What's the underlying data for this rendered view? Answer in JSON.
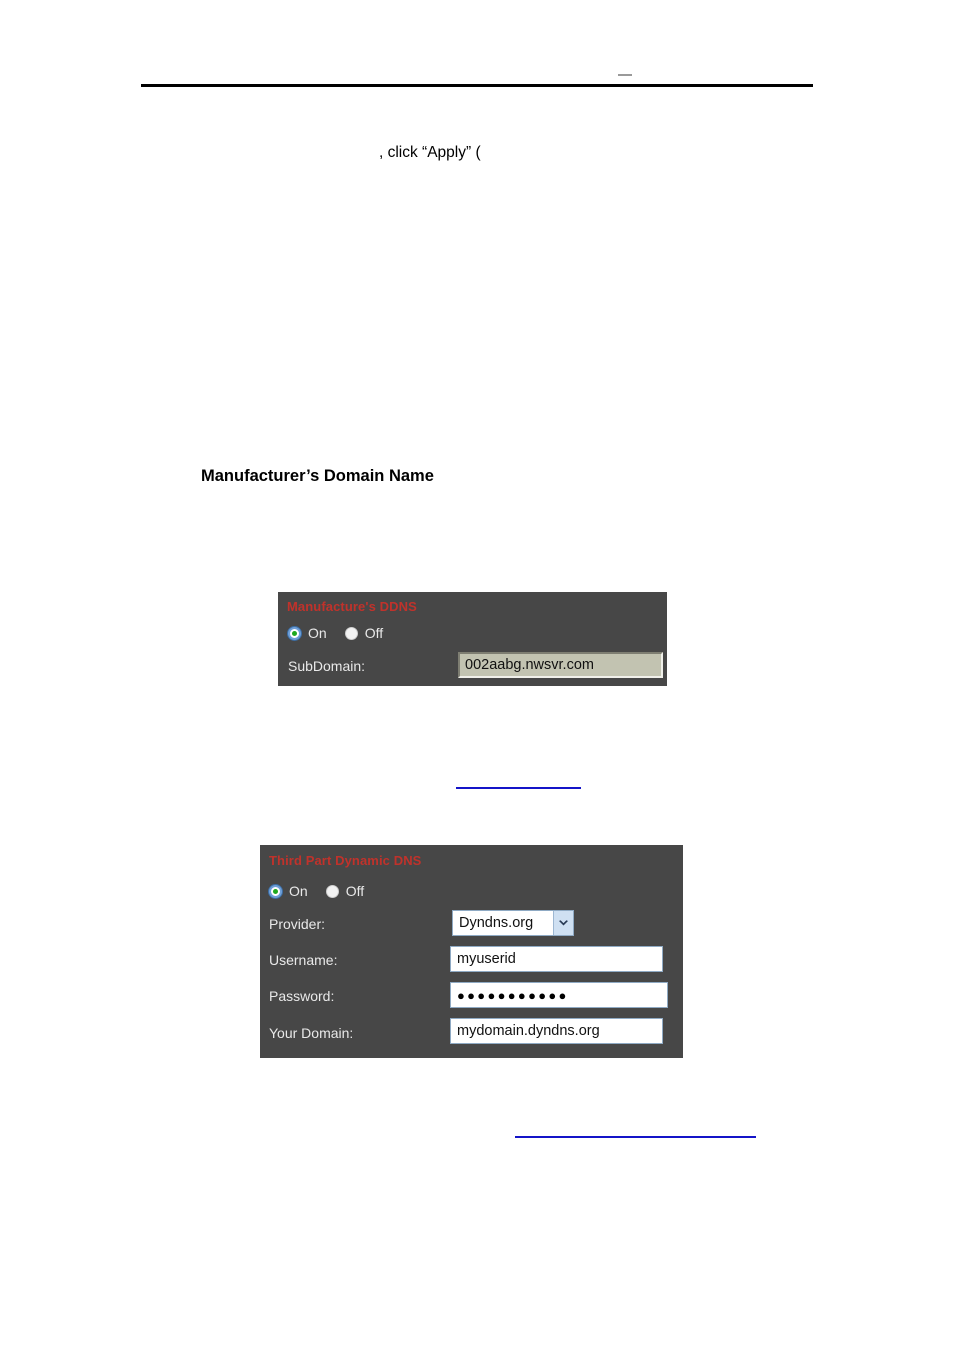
{
  "page": {
    "header_rule": true,
    "body_fragment": ", click “Apply” (",
    "section_heading": "Manufacturer’s Domain Name",
    "link_1_text": "",
    "link_2_text": ""
  },
  "colors": {
    "panel_background": "#474747",
    "panel_title": "#c0322b",
    "label_text": "#e9e9e9",
    "link_underline": "#1414c8",
    "radio_selected_dot": "#1ea81e",
    "inset_field_fill": "#c2c3b1",
    "select_arrow_fill": "#cfe0f2"
  },
  "manufacture_ddns": {
    "title": "Manufacture's DDNS",
    "radio": {
      "on_label": "On",
      "off_label": "Off",
      "selected": "On"
    },
    "subdomain": {
      "label": "SubDomain:",
      "value": "002aabg.nwsvr.com"
    }
  },
  "third_party_ddns": {
    "title": "Third Part Dynamic DNS",
    "radio": {
      "on_label": "On",
      "off_label": "Off",
      "selected": "On"
    },
    "provider": {
      "label": "Provider:",
      "value": "Dyndns.org",
      "options": [
        "Dyndns.org"
      ],
      "arrow_icon": "chevron-down-icon"
    },
    "username": {
      "label": "Username:",
      "value": "myuserid"
    },
    "password": {
      "label": "Password:",
      "value": "●●●●●●●●●●●"
    },
    "your_domain": {
      "label": "Your Domain:",
      "value": "mydomain.dyndns.org"
    }
  }
}
